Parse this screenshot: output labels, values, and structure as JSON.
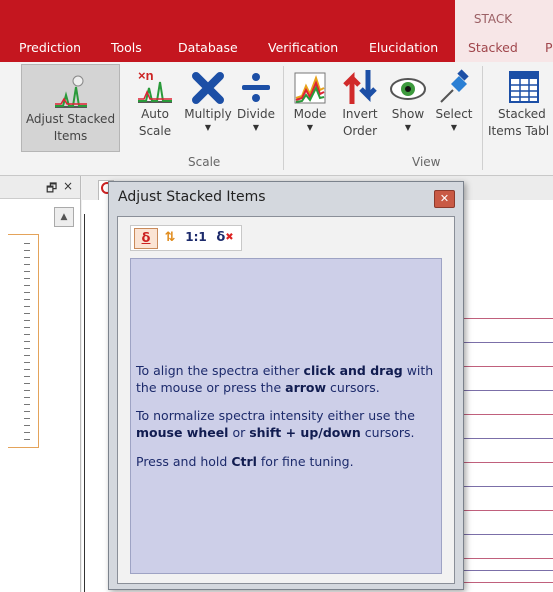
{
  "ribbon": {
    "contextual_group": "STACK",
    "tabs": [
      "Prediction",
      "Tools",
      "Database",
      "Verification",
      "Elucidation",
      "Stacked",
      "P"
    ],
    "buttons": {
      "adjust": {
        "line1": "Adjust Stacked",
        "line2": "Items"
      },
      "auto_scale": {
        "line1": "Auto",
        "line2": "Scale"
      },
      "multiply": {
        "line1": "Multiply"
      },
      "divide": {
        "line1": "Divide"
      },
      "mode": {
        "line1": "Mode"
      },
      "invert": {
        "line1": "Invert",
        "line2": "Order"
      },
      "show": {
        "line1": "Show"
      },
      "select": {
        "line1": "Select"
      },
      "table": {
        "line1": "Stacked",
        "line2": "Items Tabl"
      }
    },
    "groups": {
      "scale": "Scale",
      "view": "View"
    },
    "icons": {
      "adjust": "spectrum-hand-icon",
      "auto_scale": "spectrum-multiply-icon",
      "multiply": "x-icon",
      "divide": "divide-icon",
      "mode": "colored-spectra-icon",
      "invert": "up-down-arrows-icon",
      "show": "eye-icon",
      "select": "pin-icon",
      "table": "table-icon"
    }
  },
  "panes": {
    "pin_glyph": "🗗",
    "close_glyph": "×",
    "scroll_up": "▲"
  },
  "dialog": {
    "title": "Adjust Stacked Items",
    "close_glyph": "✕",
    "toolbar": {
      "shift": "δ",
      "stack": "⇅",
      "ratio": "1:1",
      "reset": "δ"
    },
    "instructions": {
      "p1": {
        "a": "To align the spectra either ",
        "b": "click and drag",
        "c": " with the mouse or press the ",
        "d": "arrow",
        "e": " cursors."
      },
      "p2": {
        "a": "To normalize spectra intensity either use the ",
        "b": "mouse wheel",
        "c": " or ",
        "d": "shift + up/down",
        "e": " cursors."
      },
      "p3": {
        "a": "Press and hold ",
        "b": "Ctrl",
        "c": " for fine tuning."
      }
    }
  },
  "colors": {
    "ribbon_red": "#c4161f",
    "panel": "#cdcfe8",
    "text_blue": "#1c2a6b"
  }
}
